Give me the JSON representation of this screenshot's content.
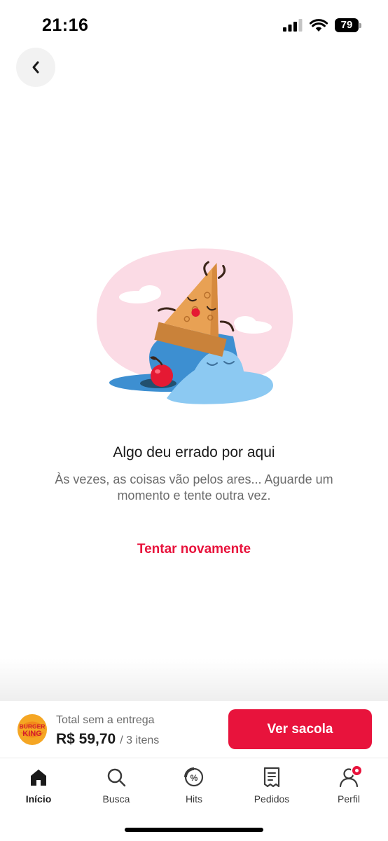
{
  "status_bar": {
    "time": "21:16",
    "battery": "79"
  },
  "error": {
    "title": "Algo deu errado por aqui",
    "message": "Às vezes, as coisas vão pelos ares... Aguarde um momento e tente outra vez.",
    "retry_label": "Tentar novamente"
  },
  "bag": {
    "store_logo_text": [
      "BURGER",
      "KING"
    ],
    "label": "Total sem a entrega",
    "price": "R$ 59,70",
    "count": "/ 3 itens",
    "button_label": "Ver sacola"
  },
  "tabs": [
    {
      "label": "Início",
      "icon": "home-icon",
      "active": true
    },
    {
      "label": "Busca",
      "icon": "search-icon",
      "active": false
    },
    {
      "label": "Hits",
      "icon": "discount-icon",
      "active": false
    },
    {
      "label": "Pedidos",
      "icon": "receipt-icon",
      "active": false
    },
    {
      "label": "Perfil",
      "icon": "user-icon",
      "active": false
    }
  ],
  "colors": {
    "accent": "#e8133c",
    "illustration_pink": "#fbdbe5",
    "illustration_blue": "#4ea6e0"
  }
}
